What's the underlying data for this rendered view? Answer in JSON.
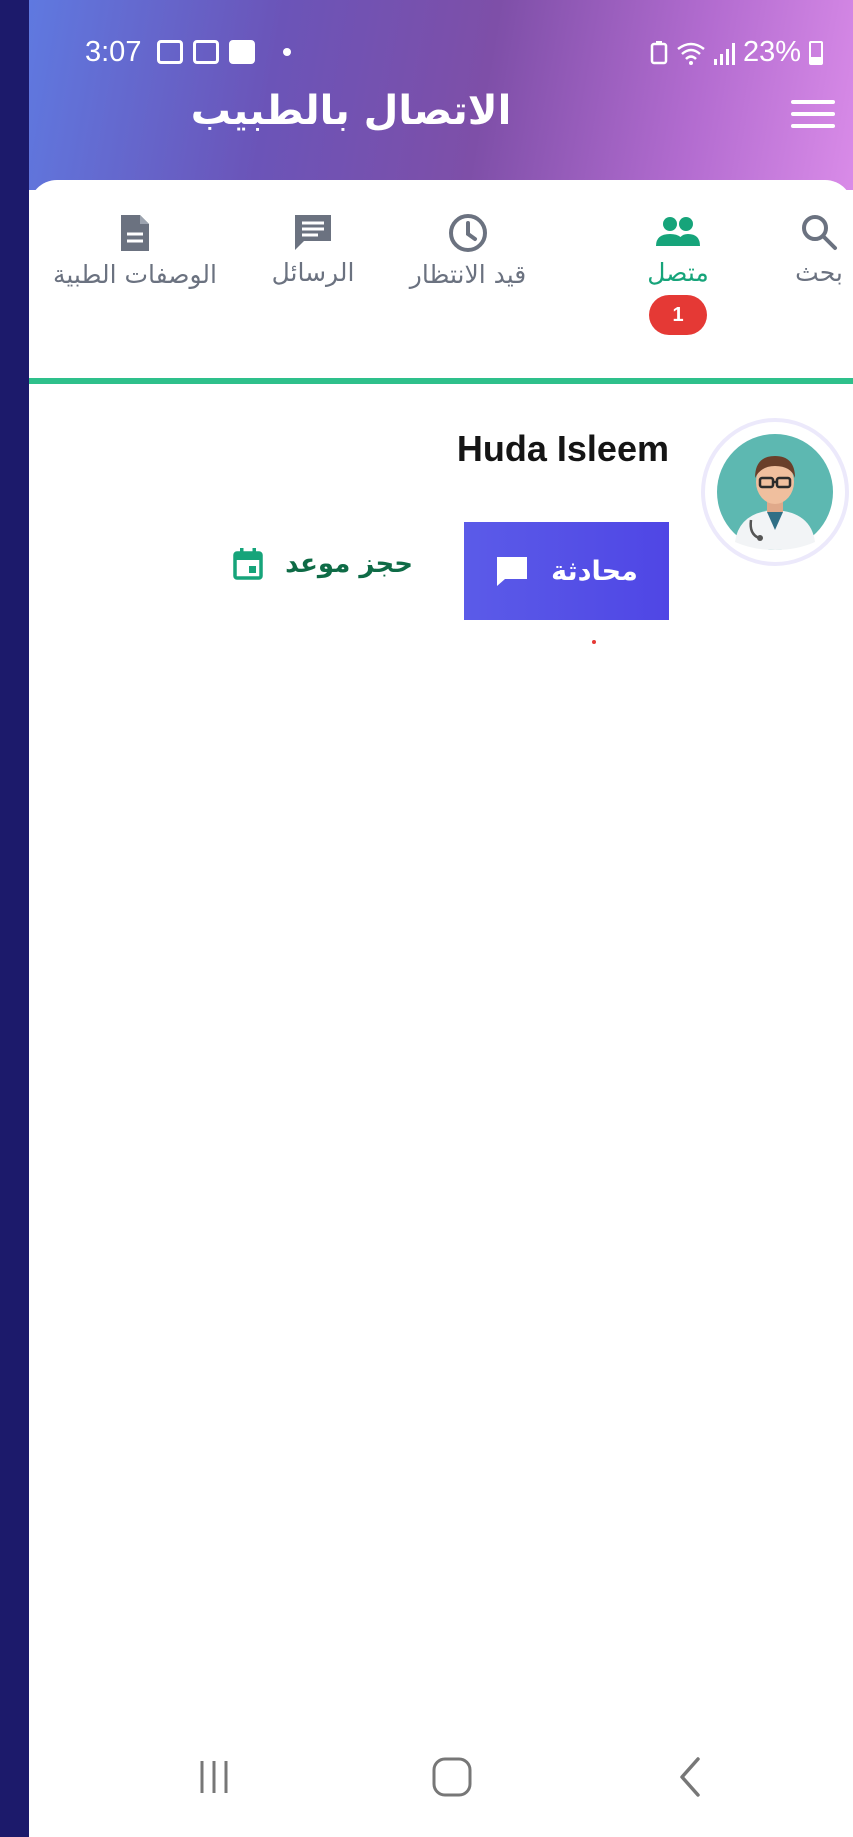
{
  "status_bar": {
    "time": "3:07",
    "battery": "23%"
  },
  "header": {
    "title": "الاتصال بالطبيب"
  },
  "tabs": [
    {
      "label": "بحث",
      "icon": "search-icon"
    },
    {
      "label": "متصل",
      "icon": "people-icon",
      "badge": "1",
      "active": true
    },
    {
      "label": "قيد الانتظار",
      "icon": "clock-icon"
    },
    {
      "label": "الرسائل",
      "icon": "message-icon"
    },
    {
      "label": "الوصفات الطبية",
      "icon": "document-icon"
    }
  ],
  "doctor": {
    "name": "Huda Isleem",
    "chat_label": "محادثة",
    "book_label": "حجز موعد"
  },
  "colors": {
    "accent_green": "#16a47a",
    "chat_button": "#4f46e5",
    "badge_red": "#e53935"
  }
}
